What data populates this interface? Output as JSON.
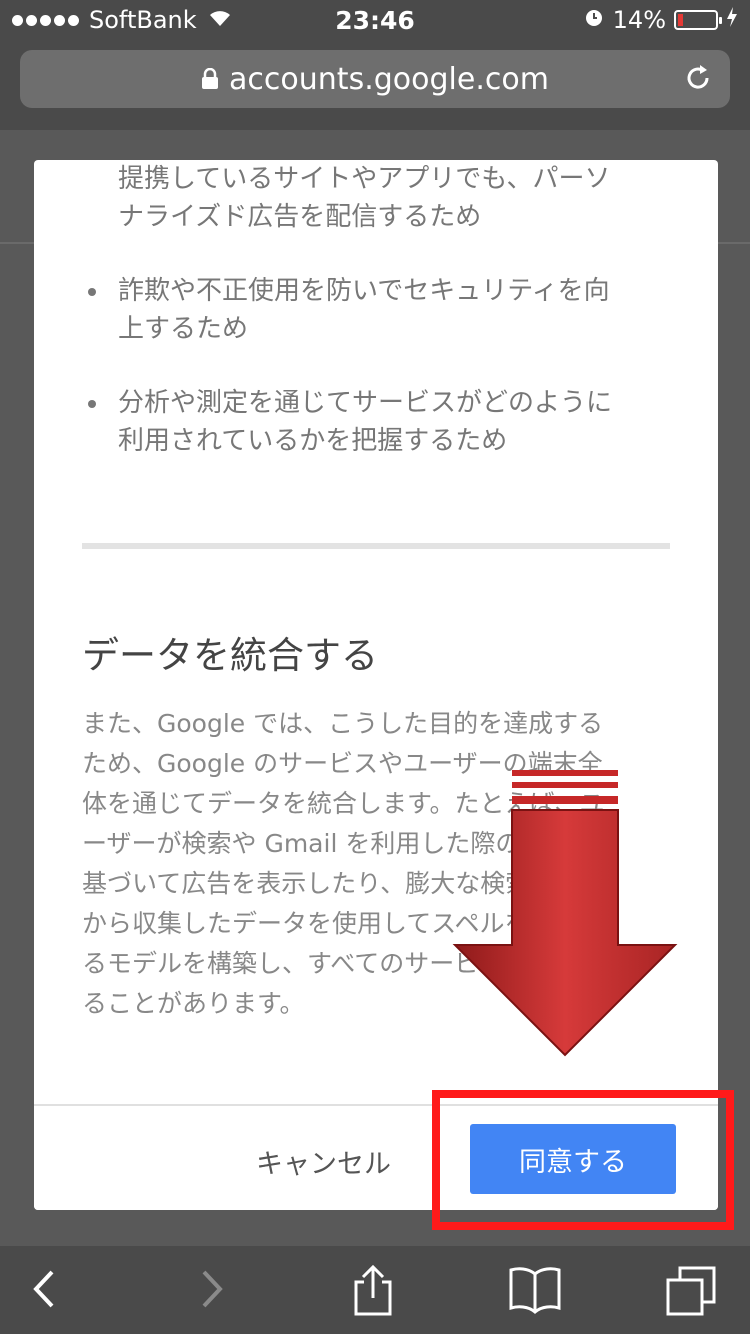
{
  "status_bar": {
    "carrier": "SoftBank",
    "time": "23:46",
    "battery": "14%",
    "battery_level": 0.14
  },
  "browser": {
    "url": "accounts.google.com"
  },
  "dialog": {
    "top_item_lines": [
      "提携しているサイトやアプリでも、パーソ",
      "ナライズド広告を配信するため"
    ],
    "bullets": [
      {
        "line1": "詐欺や不正使用を防いでセキュリティを向",
        "line2": "上するため"
      },
      {
        "line1": "分析や測定を通じてサービスがどのように",
        "line2": "利用されているかを把握するため"
      }
    ],
    "section_title": "データを統合する",
    "paragraph_lines": [
      "また、Google では、こうした目的を達成する",
      "ため、Google のサービスやユーザーの端末全",
      "体を通じてデータを統合します。たとえば、ユ",
      "ーザーが検索や Gmail を利用した際の内容に",
      "基づいて広告を表示したり、膨大な検索クエリ",
      "から収集したデータを使用してスペルを修正す",
      "るモデルを構築し、すべてのサービスで使用す",
      "ることがあります。"
    ],
    "cancel_label": "キャンセル",
    "agree_label": "同意する"
  },
  "colors": {
    "accent": "#4285f4",
    "highlight": "#ff1a1a",
    "arrow": "#c62828"
  }
}
